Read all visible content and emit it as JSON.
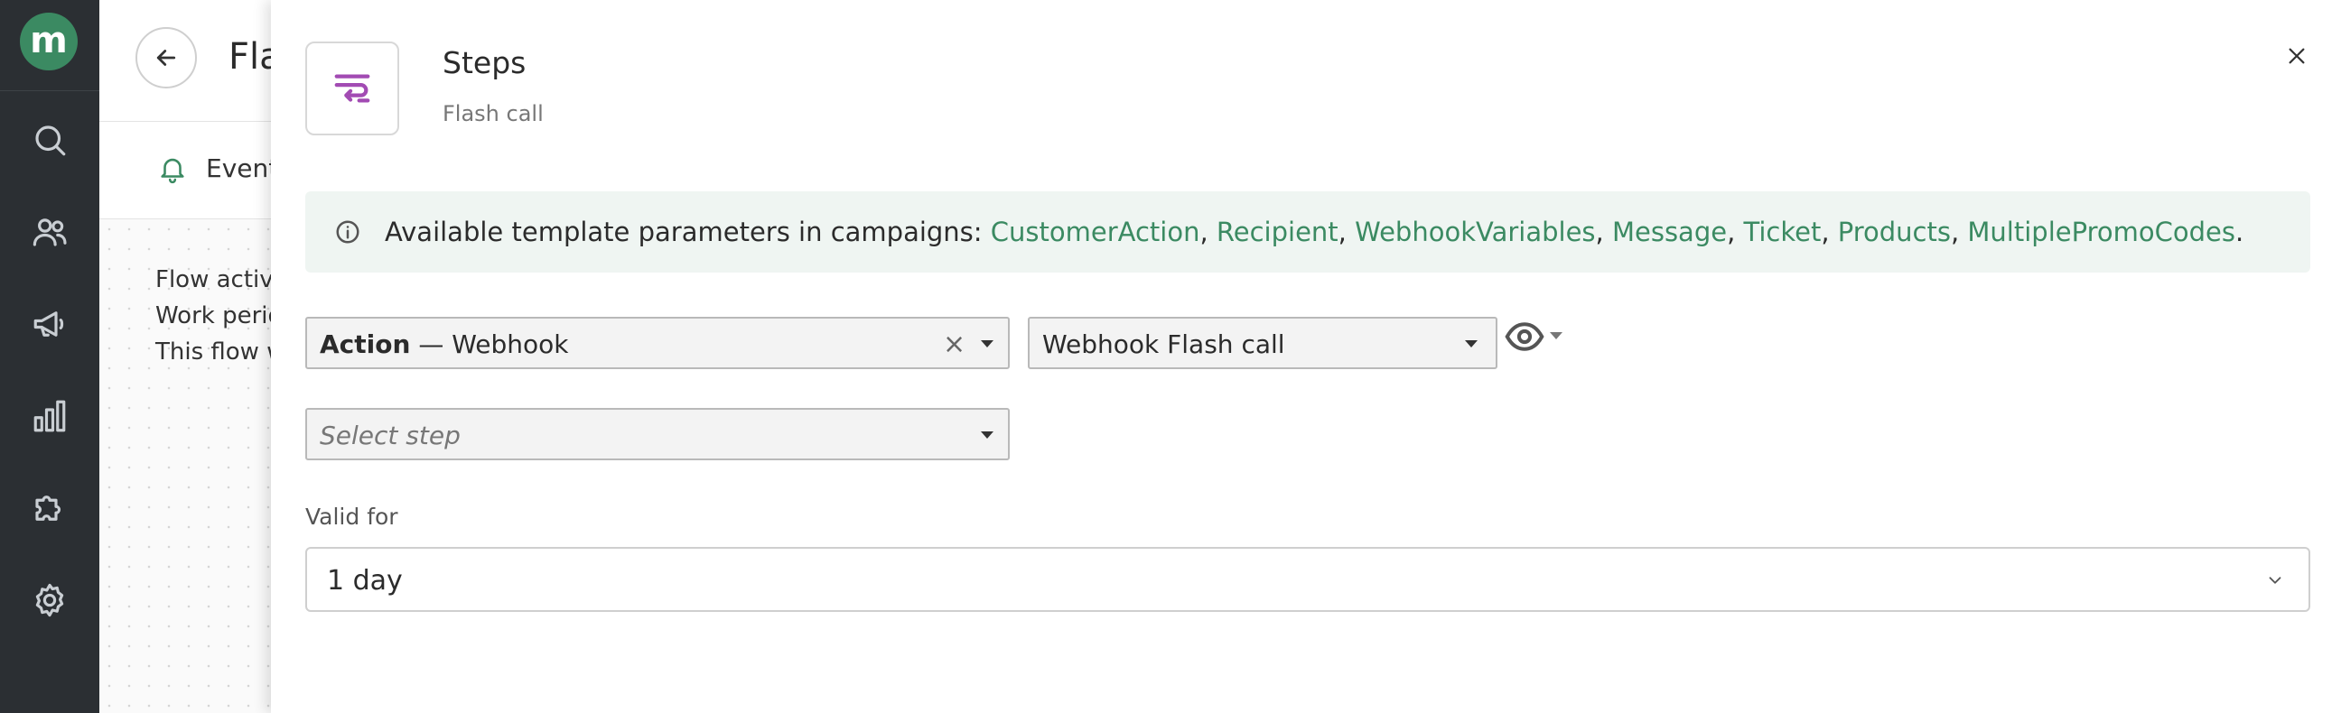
{
  "nav": {
    "logo_letter": "m",
    "items": [
      {
        "icon": "search-icon"
      },
      {
        "icon": "users-icon"
      },
      {
        "icon": "megaphone-icon"
      },
      {
        "icon": "analytics-icon"
      },
      {
        "icon": "puzzle-icon"
      },
      {
        "icon": "gear-icon"
      }
    ]
  },
  "background_page": {
    "title": "Flash call",
    "tab_label": "Events",
    "lines": [
      "Flow active",
      "Work period",
      "This flow will"
    ]
  },
  "drawer": {
    "title": "Steps",
    "subtitle": "Flash call",
    "info": {
      "prefix": "Available template parameters in campaigns: ",
      "links": [
        "CustomerAction",
        "Recipient",
        "WebhookVariables",
        "Message",
        "Ticket",
        "Products",
        "MultiplePromoCodes"
      ],
      "suffix": "."
    },
    "action_select": {
      "bold": "Action",
      "rest": " — Webhook"
    },
    "webhook_select": {
      "value": "Webhook Flash call"
    },
    "step_select": {
      "placeholder": "Select step"
    },
    "valid_for": {
      "label": "Valid for",
      "value": "1 day"
    }
  },
  "colors": {
    "accent_green": "#3b8a62",
    "nav_bg": "#2b2f33",
    "step_icon_purple": "#a24bb3",
    "info_bg": "#eff5f2"
  }
}
